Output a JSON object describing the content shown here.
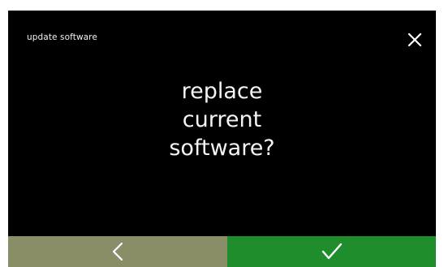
{
  "header": {
    "title": "update software",
    "close_icon": "close-icon"
  },
  "dialog": {
    "message_lines": [
      "replace",
      "current",
      "software?"
    ]
  },
  "footer": {
    "back_icon": "chevron-left-icon",
    "confirm_icon": "checkmark-icon"
  },
  "colors": {
    "background": "#000000",
    "text": "#f4f4f4",
    "back_button": "#8a8e66",
    "confirm_button": "#1f8d2c",
    "icon": "#ffffff"
  }
}
